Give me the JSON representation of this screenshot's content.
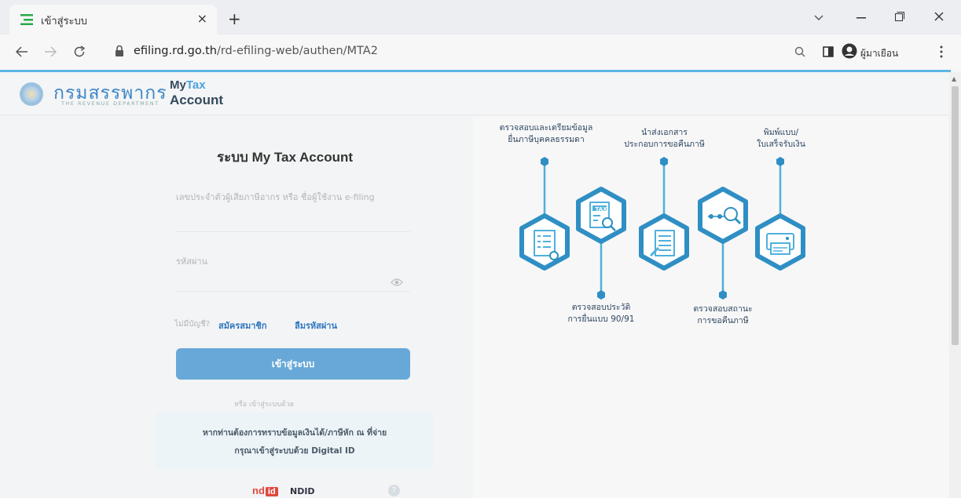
{
  "browser": {
    "tab_title": "เข้าสู่ระบบ",
    "tab_close": "×",
    "new_tab": "+",
    "url_host": "efiling.rd.go.th",
    "url_path": "/rd-efiling-web/authen/MTA2",
    "profile_name": "ผู้มาเยือน",
    "icons": [
      "back-icon",
      "forward-icon",
      "reload-icon",
      "lock-icon",
      "zoom-icon",
      "sidepanel-icon",
      "profile-icon",
      "menu-icon"
    ]
  },
  "header": {
    "logo_text": "กรมสรรพากร",
    "logo_subtext": "THE REVENUE DEPARTMENT",
    "app_my": "My",
    "app_tax": "Tax",
    "app_account": "Account"
  },
  "login": {
    "title": "ระบบ My Tax Account",
    "username_label": "เลขประจำตัวผู้เสียภาษีอากร หรือ ชื่อผู้ใช้งาน e-filing",
    "username_value": "",
    "password_label": "รหัสผ่าน",
    "password_value": "",
    "no_account": "ไม่มีบัญชี?",
    "register": "สมัครสมาชิก",
    "forgot": "ลืมรหัสผ่าน",
    "login_button": "เข้าสู่ระบบ",
    "or_text": "หรือ เข้าสู่ระบบด้วย",
    "digital_id_line1": "หากท่านต้องการทราบข้อมูลเงินได้/ภาษีหัก ณ ที่จ่าย",
    "digital_id_line2": "กรุณาเข้าสู่ระบบด้วย Digital ID",
    "ndid_logo_a": "nd",
    "ndid_logo_b": "id",
    "ndid_label": "NDID",
    "help": "?"
  },
  "infographic": {
    "top_labels": [
      {
        "line1": "ตรวจสอบและเตรียมข้อมูล",
        "line2": "ยื่นภาษีบุคคลธรรมดา"
      },
      {
        "line1": "นำส่งเอกสาร",
        "line2": "ประกอบการขอคืนภาษี"
      },
      {
        "line1": "พิมพ์แบบ/",
        "line2": "ใบเสร็จรับเงิน"
      }
    ],
    "bottom_labels": [
      {
        "line1": "ตรวจสอบประวัติ",
        "line2": "การยื่นแบบ 90/91"
      },
      {
        "line1": "ตรวจสอบสถานะ",
        "line2": "การขอคืนภาษี"
      }
    ],
    "tax_badge": "TAX",
    "colors": {
      "hex_stroke": "#4fb0dc",
      "hex_fill": "#2f8fc4",
      "icon_bg": "#ffffff"
    }
  },
  "colors": {
    "accent": "#5bb7e5",
    "link": "#2e76c0",
    "button": "#68a8d8"
  }
}
